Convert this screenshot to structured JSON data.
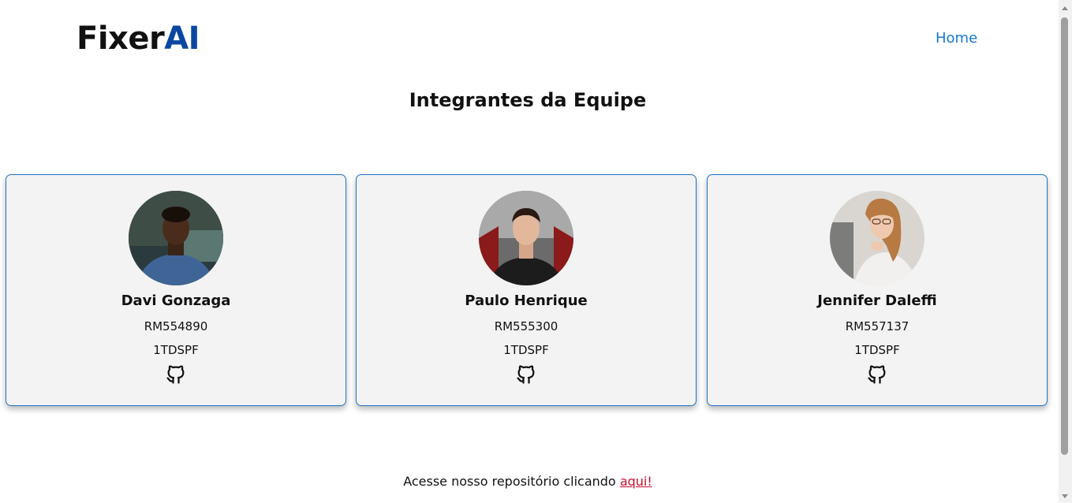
{
  "header": {
    "logo_main": "Fixer",
    "logo_accent": "AI",
    "nav_home": "Home"
  },
  "main": {
    "title": "Integrantes da Equipe"
  },
  "members": [
    {
      "name": "Davi Gonzaga",
      "rm": "RM554890",
      "turma": "1TDSPF",
      "icon": "github-icon"
    },
    {
      "name": "Paulo Henrique",
      "rm": "RM555300",
      "turma": "1TDSPF",
      "icon": "github-icon"
    },
    {
      "name": "Jennifer Daleffi",
      "rm": "RM557137",
      "turma": "1TDSPF",
      "icon": "github-icon"
    }
  ],
  "footer": {
    "text": "Acesse nosso repositório clicando ",
    "link": "aqui!"
  },
  "colors": {
    "brand_accent": "#0a47a0",
    "link_blue": "#1678cf",
    "card_border": "#1f74c9",
    "footer_link": "#c8102e"
  }
}
